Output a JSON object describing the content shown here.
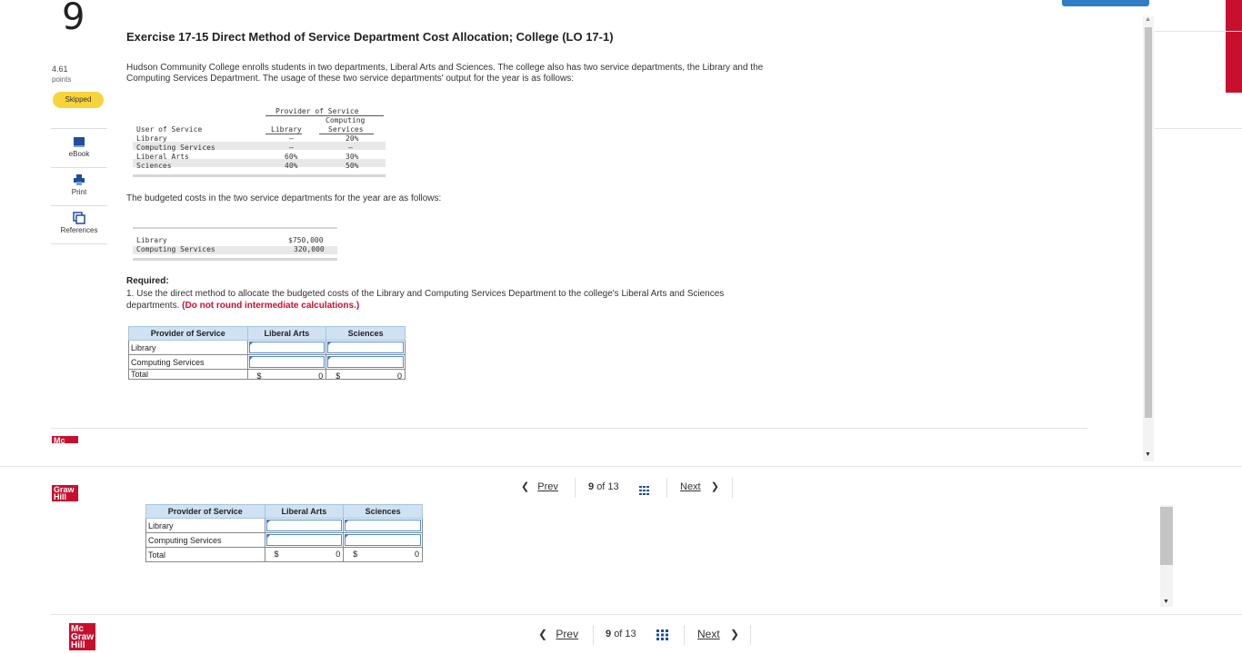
{
  "question": {
    "number": "9",
    "title": "Exercise 17-15 Direct Method of Service Department Cost Allocation; College (LO 17-1)",
    "points_value": "4.61",
    "points_label": "points",
    "status": "Skipped"
  },
  "tools": [
    {
      "label": "eBook",
      "icon": "book-icon"
    },
    {
      "label": "Print",
      "icon": "printer-icon"
    },
    {
      "label": "References",
      "icon": "references-icon"
    }
  ],
  "intro": "Hudson Community College enrolls students in two departments, Liberal Arts and Sciences. The college also has two service departments, the Library and the Computing Services Department. The usage of these two service departments' output for the year is as follows:",
  "usage_table": {
    "group_header": "Provider of Service",
    "user_header": "User of Service",
    "col_library": "Library",
    "col_computing_1": "Computing",
    "col_computing_2": "Services",
    "rows": [
      {
        "user": "Library",
        "library": "—",
        "computing": "20%"
      },
      {
        "user": "Computing Services",
        "library": "—",
        "computing": "—"
      },
      {
        "user": "Liberal Arts",
        "library": "60%",
        "computing": "30%"
      },
      {
        "user": "Sciences",
        "library": "40%",
        "computing": "50%"
      }
    ]
  },
  "budget_text": "The budgeted costs in the two service departments for the year are as follows:",
  "budget_table": {
    "rows": [
      {
        "dept": "Library",
        "cost": "$750,000"
      },
      {
        "dept": "Computing Services",
        "cost": "320,000"
      }
    ]
  },
  "required": {
    "heading": "Required:",
    "body": "1. Use the direct method to allocate the budgeted costs of the Library and Computing Services Department to the college's Liberal Arts and Sciences departments.",
    "note": "(Do not round intermediate calculations.)"
  },
  "answer_table": {
    "headers": [
      "Provider of Service",
      "Liberal Arts",
      "Sciences"
    ],
    "rows": [
      "Library",
      "Computing Services"
    ],
    "total_label": "Total",
    "currency": "$",
    "liberal_total": "0",
    "sciences_total": "0"
  },
  "nav": {
    "prev": "Prev",
    "page": "9",
    "of_label": "of 13",
    "next": "Next"
  },
  "logo": {
    "line1": "Mc",
    "line2": "Graw",
    "line3": "Hill"
  }
}
